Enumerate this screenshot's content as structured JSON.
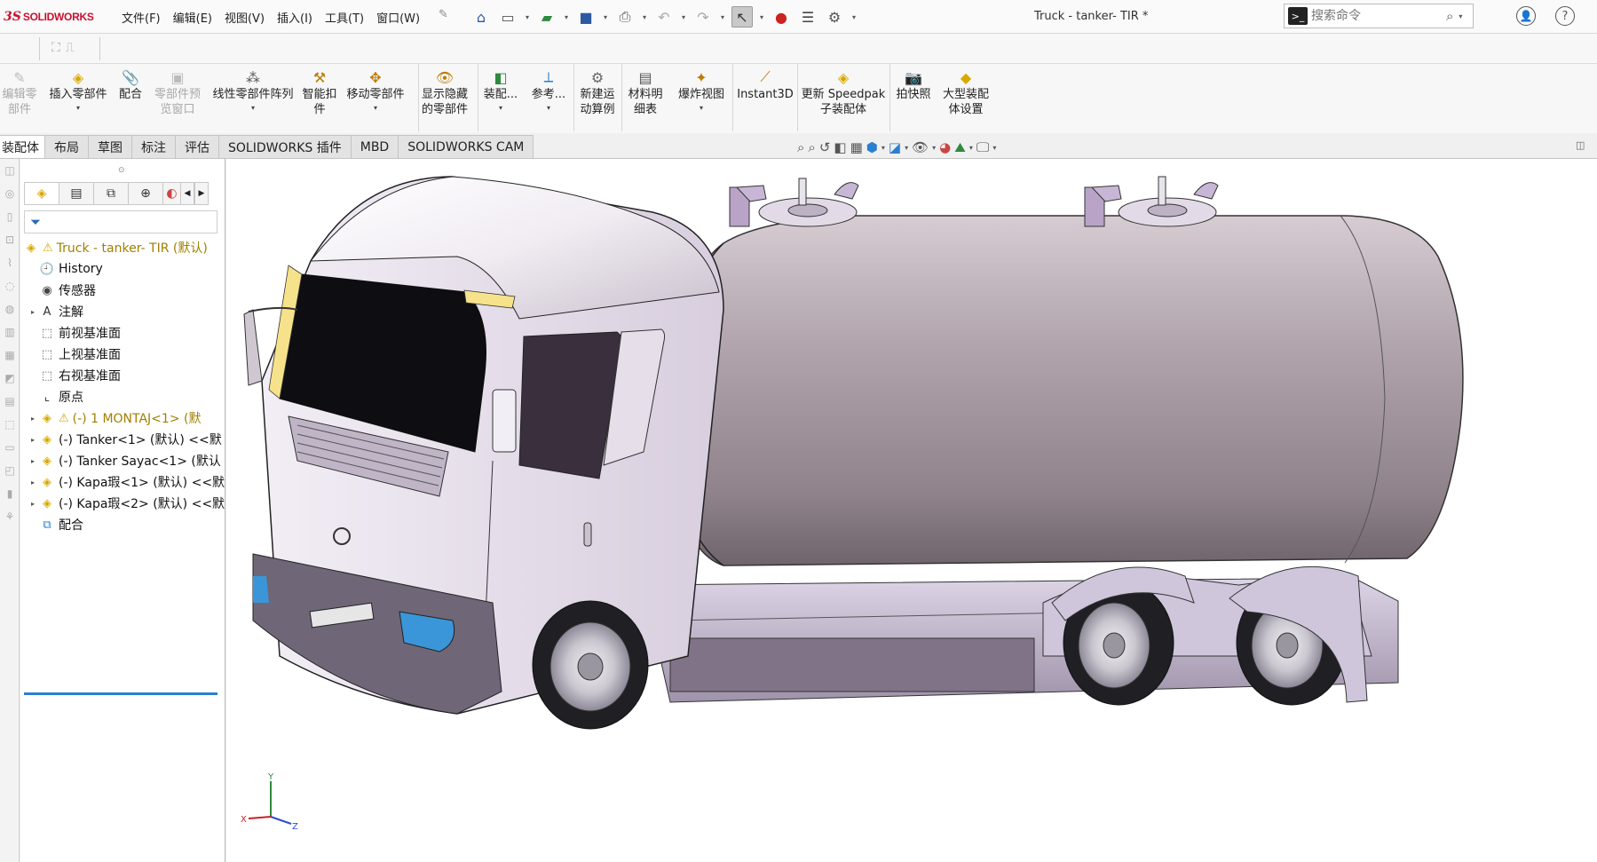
{
  "app": {
    "logo_ds": "3S",
    "logo_name": "SOLIDWORKS",
    "document_title": "Truck - tanker- TIR *"
  },
  "menu": [
    "文件(F)",
    "编辑(E)",
    "视图(V)",
    "插入(I)",
    "工具(T)",
    "窗口(W)"
  ],
  "search": {
    "placeholder": "搜索命令"
  },
  "commands": [
    {
      "label1": "编辑零",
      "label2": "部件",
      "enabled": false,
      "icon": "edit-component-icon"
    },
    {
      "label1": "插入零部件",
      "label2": "",
      "enabled": true,
      "icon": "insert-component-icon"
    },
    {
      "label1": "配合",
      "label2": "",
      "enabled": true,
      "icon": "mate-icon"
    },
    {
      "label1": "零部件预",
      "label2": "览窗口",
      "enabled": false,
      "icon": "preview-window-icon"
    },
    {
      "label1": "线性零部件阵列",
      "label2": "",
      "enabled": true,
      "icon": "linear-pattern-icon"
    },
    {
      "label1": "智能扣",
      "label2": "件",
      "enabled": true,
      "icon": "smart-fastener-icon"
    },
    {
      "label1": "移动零部件",
      "label2": "",
      "enabled": true,
      "icon": "move-component-icon"
    },
    {
      "label1": "显示隐藏",
      "label2": "的零部件",
      "enabled": true,
      "icon": "show-hidden-icon"
    },
    {
      "label1": "装配...",
      "label2": "",
      "enabled": true,
      "icon": "assembly-features-icon"
    },
    {
      "label1": "参考...",
      "label2": "",
      "enabled": true,
      "icon": "reference-geometry-icon"
    },
    {
      "label1": "新建运",
      "label2": "动算例",
      "enabled": true,
      "icon": "motion-study-icon"
    },
    {
      "label1": "材料明",
      "label2": "细表",
      "enabled": true,
      "icon": "bom-icon"
    },
    {
      "label1": "爆炸视图",
      "label2": "",
      "enabled": true,
      "icon": "exploded-view-icon"
    },
    {
      "label1": "Instant3D",
      "label2": "",
      "enabled": true,
      "icon": "instant3d-icon"
    },
    {
      "label1": "更新 Speedpak",
      "label2": "子装配体",
      "enabled": true,
      "icon": "speedpak-icon"
    },
    {
      "label1": "拍快照",
      "label2": "",
      "enabled": true,
      "icon": "snapshot-icon"
    },
    {
      "label1": "大型装配",
      "label2": "体设置",
      "enabled": true,
      "icon": "large-assembly-icon"
    }
  ],
  "tabs": [
    "装配体",
    "布局",
    "草图",
    "标注",
    "评估",
    "SOLIDWORKS 插件",
    "MBD",
    "SOLIDWORKS CAM"
  ],
  "active_tab": "装配体",
  "tree": {
    "root": "Truck - tanker- TIR (默认)",
    "items": [
      {
        "label": "History",
        "icon": "history-icon",
        "expandable": false,
        "warn": false
      },
      {
        "label": "传感器",
        "icon": "sensor-icon",
        "expandable": false,
        "warn": false
      },
      {
        "label": "注解",
        "icon": "annotation-icon",
        "expandable": true,
        "warn": false
      },
      {
        "label": "前视基准面",
        "icon": "plane-icon",
        "expandable": false,
        "warn": false
      },
      {
        "label": "上视基准面",
        "icon": "plane-icon",
        "expandable": false,
        "warn": false
      },
      {
        "label": "右视基准面",
        "icon": "plane-icon",
        "expandable": false,
        "warn": false
      },
      {
        "label": "原点",
        "icon": "origin-icon",
        "expandable": false,
        "warn": false
      },
      {
        "label": "(-) 1 MONTAJ<1> (默",
        "icon": "subassembly-icon",
        "expandable": true,
        "warn": true
      },
      {
        "label": "(-) Tanker<1> (默认) <<默",
        "icon": "subassembly-icon",
        "expandable": true,
        "warn": false
      },
      {
        "label": "(-) Tanker Sayac<1> (默认",
        "icon": "subassembly-icon",
        "expandable": true,
        "warn": false
      },
      {
        "label": "(-) Kapa瑕<1> (默认) <<默",
        "icon": "subassembly-icon",
        "expandable": true,
        "warn": false
      },
      {
        "label": "(-) Kapa瑕<2> (默认) <<默",
        "icon": "subassembly-icon",
        "expandable": true,
        "warn": false
      },
      {
        "label": "配合",
        "icon": "mates-folder-icon",
        "expandable": false,
        "warn": false
      }
    ]
  },
  "triad": {
    "x": "X",
    "y": "Y",
    "z": "Z"
  },
  "colors": {
    "brand": "#c8102e",
    "tank_body": "#a89aa3",
    "cab_body": "#e8e0ea",
    "chassis": "#c7bdd3",
    "accent_blue": "#2a7fd0",
    "warning": "#d9a400"
  }
}
